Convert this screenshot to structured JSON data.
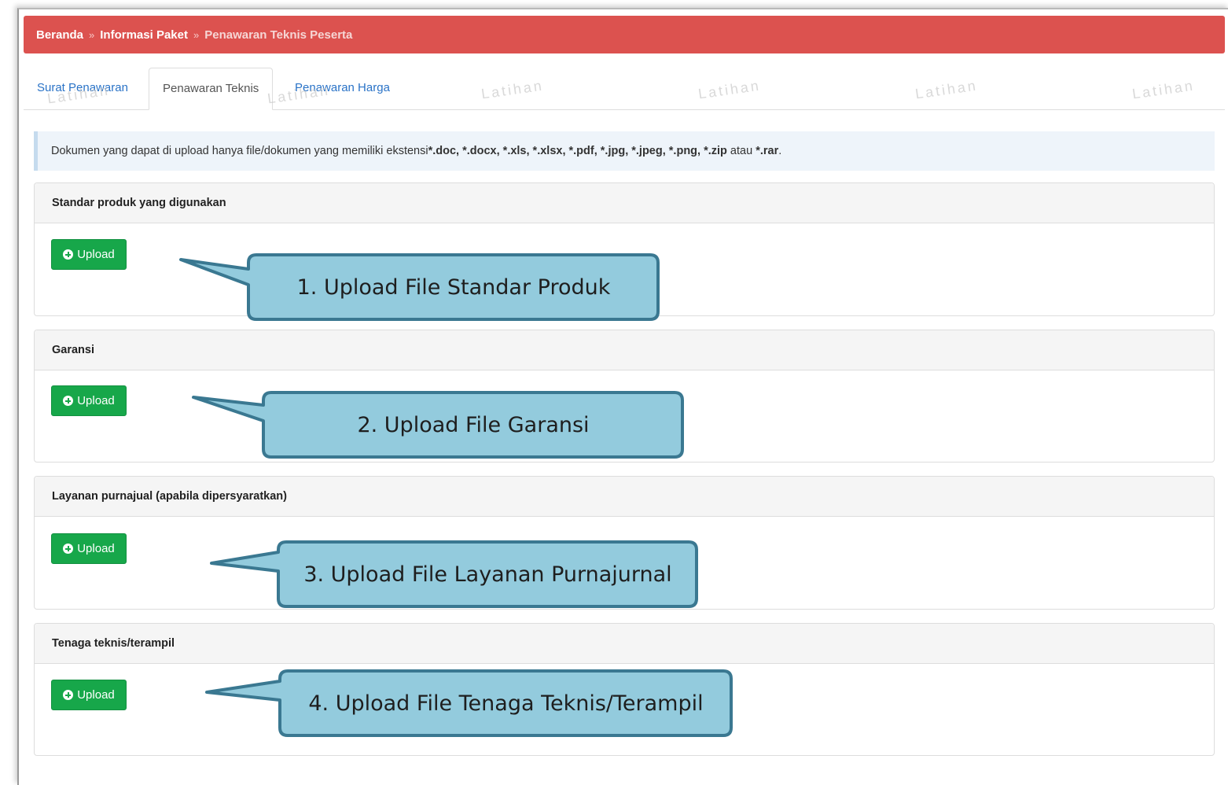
{
  "breadcrumb": {
    "home": "Beranda",
    "sep": "»",
    "package": "Informasi Paket",
    "current": "Penawaran Teknis Peserta"
  },
  "tabs": [
    {
      "label": "Surat Penawaran",
      "active": false
    },
    {
      "label": "Penawaran Teknis",
      "active": true
    },
    {
      "label": "Penawaran Harga",
      "active": false
    }
  ],
  "watermark": "Latihan",
  "info": {
    "text_start": "Dokumen yang dapat di upload hanya file/dokumen yang memiliki ekstensi ",
    "extensions": "*.doc, *.docx, *.xls, *.xlsx, *.pdf, *.jpg, *.jpeg, *.png, *.zip",
    "conj": " atau ",
    "last_ext": "*.rar",
    "end": "."
  },
  "panels": [
    {
      "title": "Standar produk yang digunakan",
      "button": "Upload",
      "callout": "1. Upload File Standar Produk"
    },
    {
      "title": "Garansi",
      "button": "Upload",
      "callout": "2. Upload File Garansi"
    },
    {
      "title": "Layanan purnajual (apabila dipersyaratkan)",
      "button": "Upload",
      "callout": "3. Upload File Layanan Purnajurnal"
    },
    {
      "title": "Tenaga teknis/terampil",
      "button": "Upload",
      "callout": "4. Upload File Tenaga Teknis/Terampil"
    }
  ],
  "colors": {
    "breadcrumb_bg": "#dc524f",
    "upload_btn": "#17a74a",
    "callout_fill": "#93cbdd",
    "callout_stroke": "#3a7891",
    "link": "#2a73c7"
  }
}
